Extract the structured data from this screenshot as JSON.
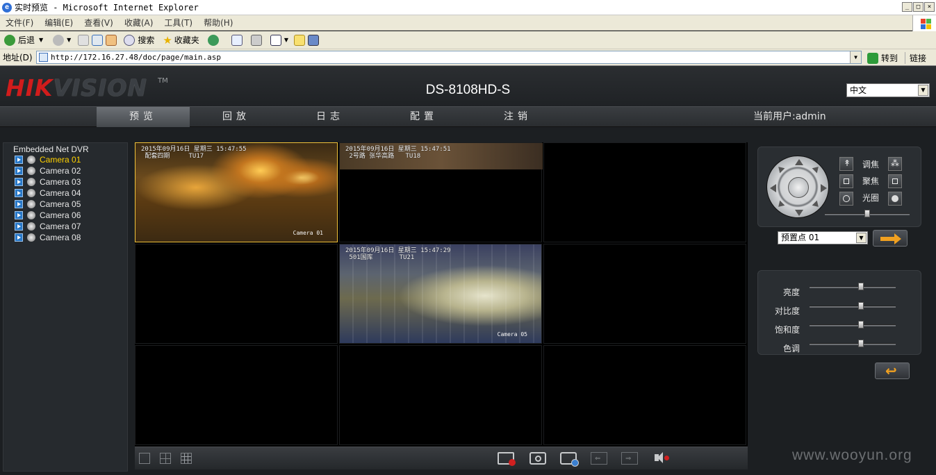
{
  "browser": {
    "title": "实时预览 - Microsoft Internet Explorer",
    "window_buttons": [
      "_",
      "□",
      "×"
    ],
    "menu": [
      "文件(F)",
      "编辑(E)",
      "查看(V)",
      "收藏(A)",
      "工具(T)",
      "帮助(H)"
    ],
    "toolbar": {
      "back": "后退",
      "search": "搜索",
      "favorites": "收藏夹"
    },
    "address_label": "地址(D)",
    "address": "http://172.16.27.48/doc/page/main.asp",
    "go": "转到",
    "links": "链接"
  },
  "header": {
    "logo_hik": "HIK",
    "logo_vision": "VISION",
    "logo_tm": "TM",
    "device": "DS-8108HD-S",
    "language": "中文"
  },
  "nav": {
    "tabs": [
      "预览",
      "回放",
      "日志",
      "配置",
      "注销"
    ],
    "active_tab": "预览",
    "user": "当前用户:admin"
  },
  "tree": {
    "root": "Embedded Net DVR",
    "cameras": [
      "Camera 01",
      "Camera 02",
      "Camera 03",
      "Camera 04",
      "Camera 05",
      "Camera 06",
      "Camera 07",
      "Camera 08"
    ],
    "selected": "Camera 01"
  },
  "video": {
    "cell1_osd": "2015年09月16日 星期三 15:47:55\n 配套四期     TU17",
    "cell1_cam": "Camera 01",
    "cell2_osd": "2015年09月16日 星期三 15:47:51\n 2号路 张华高路   TU18",
    "cell5_osd": "2015年09月16日 星期三 15:47:29\n 501国库       TU21",
    "cell5_cam": "Camera 05"
  },
  "ptz": {
    "zoom": "调焦",
    "focus": "聚焦",
    "iris": "光圈",
    "speed_level": 0.5,
    "preset": "预置点 01"
  },
  "image": {
    "brightness": "亮度",
    "contrast": "对比度",
    "saturation": "饱和度",
    "hue": "色调",
    "brightness_level": 0.6,
    "contrast_level": 0.6,
    "saturation_level": 0.6,
    "hue_level": 0.6
  },
  "watermark": "www.wooyun.org"
}
